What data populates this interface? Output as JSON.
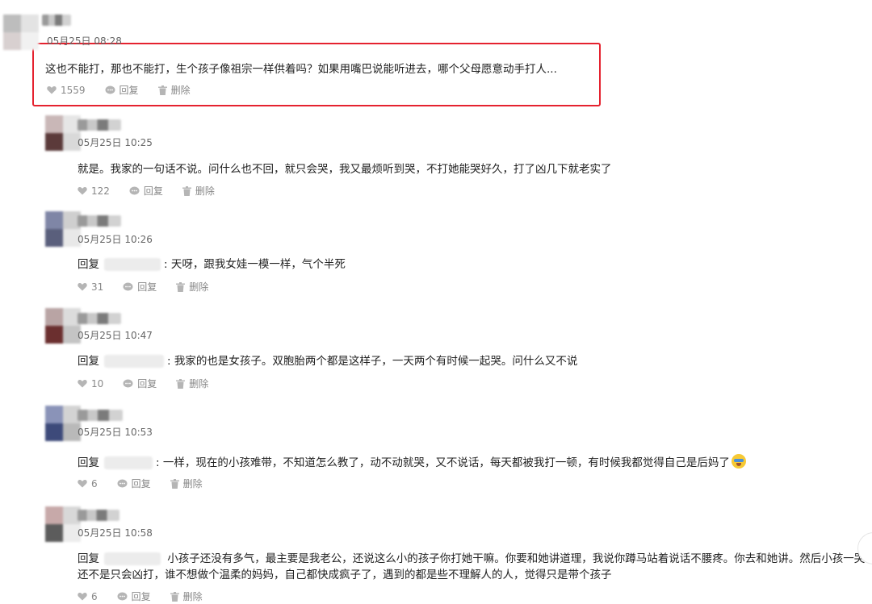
{
  "icons": {
    "like": "heart-icon",
    "reply": "chat-bubble-icon",
    "delete": "trash-icon"
  },
  "colors": {
    "highlight": "#e5222f",
    "meta": "#888888",
    "text": "#222222"
  },
  "comments": [
    {
      "time": "05月25日 08:28",
      "text": "这也不能打，那也不能打，生个孩子像祖宗一样供着吗？如果用嘴巴说能听进去，哪个父母愿意动手打人...",
      "likes": "1559",
      "reply_label": "回复",
      "delete_label": "删除"
    },
    {
      "time": "05月25日 10:25",
      "text": "就是。我家的一句话不说。问什么也不回，就只会哭，我又最烦听到哭，不打她能哭好久，打了凶几下就老实了",
      "likes": "122",
      "reply_label": "回复",
      "delete_label": "删除"
    },
    {
      "time": "05月25日 10:26",
      "reply_prefix": "回复",
      "text": "天呀，跟我女娃一模一样，气个半死",
      "likes": "31",
      "reply_label": "回复",
      "delete_label": "删除"
    },
    {
      "time": "05月25日 10:47",
      "reply_prefix": "回复",
      "text": "我家的也是女孩子。双胞胎两个都是这样子，一天两个有时候一起哭。问什么又不说",
      "likes": "10",
      "reply_label": "回复",
      "delete_label": "删除"
    },
    {
      "time": "05月25日 10:53",
      "reply_prefix": "回复",
      "text": "一样，现在的小孩难带，不知道怎么教了，动不动就哭，又不说话，每天都被我打一顿，有时候我都觉得自己是后妈了",
      "likes": "6",
      "reply_label": "回复",
      "delete_label": "删除"
    },
    {
      "time": "05月25日 10:58",
      "reply_prefix": "回复",
      "text": "小孩子还没有多气，最主要是我老公，还说这么小的孩子你打她干嘛。你要和她讲道理，我说你蹲马站着说话不腰疼。你去和她讲。然后小孩一哭还不是只会凶打，谁不想做个温柔的妈妈，自己都快成疯子了，遇到的都是些不理解人的人，觉得只是带个孩子",
      "likes": "6",
      "reply_label": "回复",
      "delete_label": "删除"
    }
  ]
}
